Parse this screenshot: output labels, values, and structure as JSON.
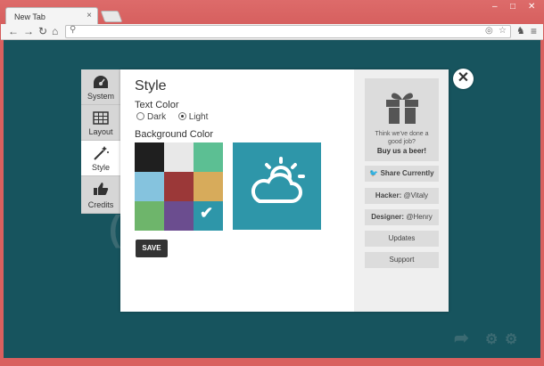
{
  "browser": {
    "tab_title": "New Tab",
    "tab_close": "×",
    "win_min": "–",
    "win_max": "□",
    "win_close": "✕",
    "back": "←",
    "forward": "→",
    "reload": "↻",
    "home": "⌂",
    "menu": "≡"
  },
  "nav": {
    "system": "System",
    "layout": "Layout",
    "style": "Style",
    "credits": "Credits"
  },
  "dialog": {
    "title": "Style",
    "text_color_label": "Text Color",
    "dark": "Dark",
    "light": "Light",
    "selected_text_color": "light",
    "bg_color_label": "Background Color",
    "swatches": [
      "#1f1f1f",
      "#e8e8e8",
      "#5cbf93",
      "#85c3de",
      "#9b3838",
      "#d7ab5b",
      "#6eb56b",
      "#6b4d8f",
      "#2e96a9"
    ],
    "selected_swatch": 8,
    "save": "SAVE",
    "close": "✕"
  },
  "sidebar": {
    "promo_line1": "Think we've done a",
    "promo_line2": "good job?",
    "promo_link": "Buy us a beer!",
    "share": "Share Currently",
    "hacker_label": "Hacker:",
    "hacker_name": "@Vitaly",
    "designer_label": "Designer:",
    "designer_name": "@Henry",
    "updates": "Updates",
    "support": "Support"
  },
  "colors": {
    "chrome": "#d9605f",
    "app_bg": "#17545e",
    "preview": "#2e96a9"
  }
}
